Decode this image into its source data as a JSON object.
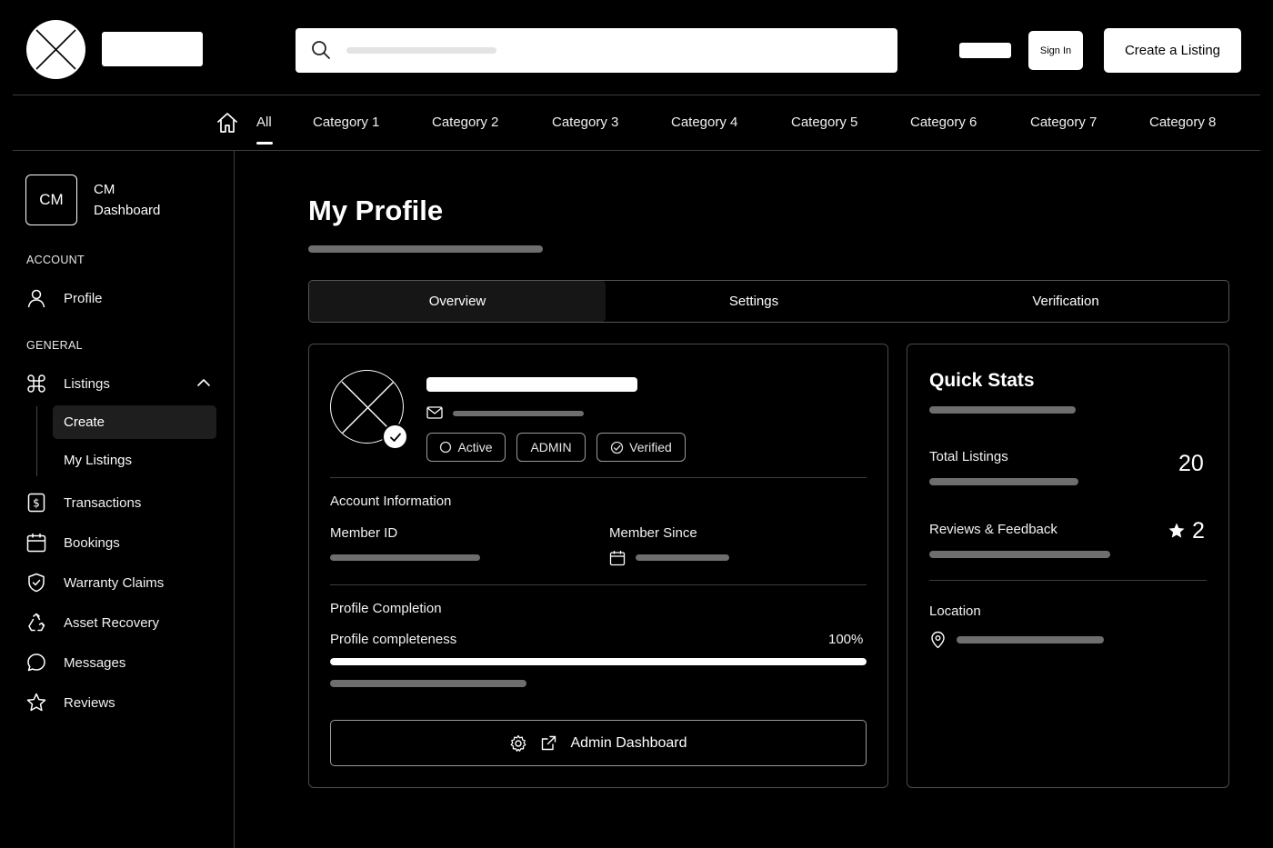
{
  "header": {
    "search_placeholder": "",
    "sign_in_label": "Sign In",
    "create_listing_label": "Create a Listing"
  },
  "nav": {
    "items": [
      "All",
      "Category 1",
      "Category 2",
      "Category 3",
      "Category 4",
      "Category 5",
      "Category 6",
      "Category 7",
      "Category 8"
    ],
    "active": "All"
  },
  "sidebar": {
    "avatar_initials": "CM",
    "user_name": "CM",
    "user_role": "Dashboard",
    "sections": {
      "account": "ACCOUNT",
      "general": "GENERAL"
    },
    "items": {
      "profile": "Profile",
      "listings": "Listings",
      "create": "Create",
      "my_listings": "My Listings",
      "transactions": "Transactions",
      "bookings": "Bookings",
      "warranty_claims": "Warranty Claims",
      "asset_recovery": "Asset Recovery",
      "messages": "Messages",
      "reviews": "Reviews"
    },
    "listings_expanded": true,
    "active_sub": "Create"
  },
  "main": {
    "title": "My Profile",
    "tabs": [
      "Overview",
      "Settings",
      "Verification"
    ],
    "active_tab": "Overview",
    "profile": {
      "badges": {
        "active": "Active",
        "admin": "ADMIN",
        "verified": "Verified"
      },
      "account_info_title": "Account Information",
      "member_id_label": "Member ID",
      "member_since_label": "Member Since",
      "completion_title": "Profile Completion",
      "completeness_label": "Profile completeness",
      "completeness_value": "100%",
      "completeness_fraction": 1.0,
      "admin_button_label": "Admin Dashboard"
    },
    "stats": {
      "title": "Quick Stats",
      "total_listings_label": "Total Listings",
      "total_listings_value": "20",
      "reviews_label": "Reviews & Feedback",
      "reviews_value": "2",
      "location_label": "Location"
    }
  },
  "colors": {
    "background": "#000000",
    "foreground": "#ffffff",
    "placeholder_bar": "#6e6e6e",
    "border": "#4a4a4a"
  }
}
